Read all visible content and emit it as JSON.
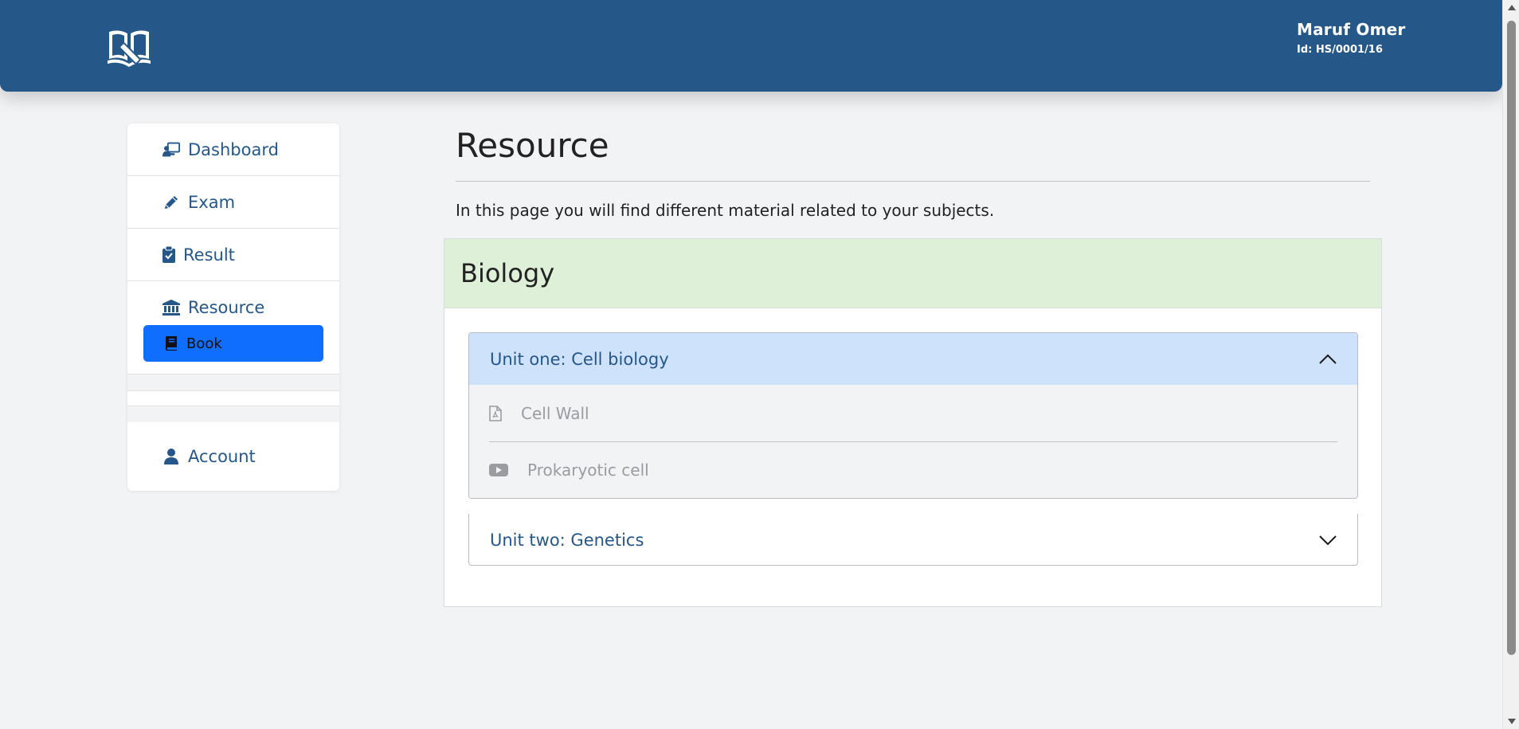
{
  "header": {
    "logo_icon": "open-book-pencil-icon",
    "user_name": "Maruf Omer",
    "user_id": "Id: HS/0001/16",
    "bg_color": "#255789"
  },
  "sidebar": {
    "items": [
      {
        "label": "Dashboard",
        "icon": "dashboard-icon"
      },
      {
        "label": "Exam",
        "icon": "pencil-icon"
      },
      {
        "label": "Result",
        "icon": "clipboard-check-icon"
      },
      {
        "label": "Resource",
        "icon": "bank-icon"
      },
      {
        "label": "Account",
        "icon": "user-icon"
      }
    ],
    "sub_item": {
      "label": "Book",
      "icon": "book-icon",
      "active_color": "#0f6efd"
    }
  },
  "main": {
    "title": "Resource",
    "description": "In this page you will find different material related to your subjects.",
    "subject": {
      "name": "Biology",
      "header_color": "#dff0d8",
      "units": [
        {
          "title": "Unit one: Cell biology",
          "expanded": true,
          "resources": [
            {
              "label": "Cell Wall",
              "icon": "pdf-file-icon"
            },
            {
              "label": "Prokaryotic cell",
              "icon": "youtube-icon"
            }
          ]
        },
        {
          "title": "Unit two: Genetics",
          "expanded": false,
          "resources": []
        }
      ]
    }
  }
}
